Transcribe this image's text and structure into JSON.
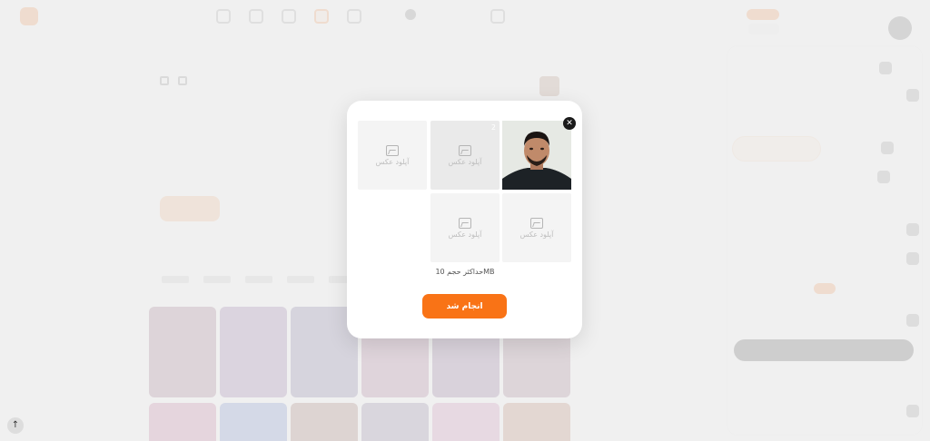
{
  "modal": {
    "close_symbol": "✕",
    "slot_label": "آپلود عکس",
    "slot2_index": "2",
    "size_note": "حداکثر حجم 10MB",
    "done_label": "انجام شد"
  },
  "colors": {
    "accent": "#f97316",
    "overlay": "#eeeeee",
    "card_bg": "#ffffff"
  },
  "icons": [
    "close-icon",
    "image-upload-icon",
    "arrow-up-icon"
  ],
  "page": {
    "scroll_up_symbol": "↑"
  }
}
